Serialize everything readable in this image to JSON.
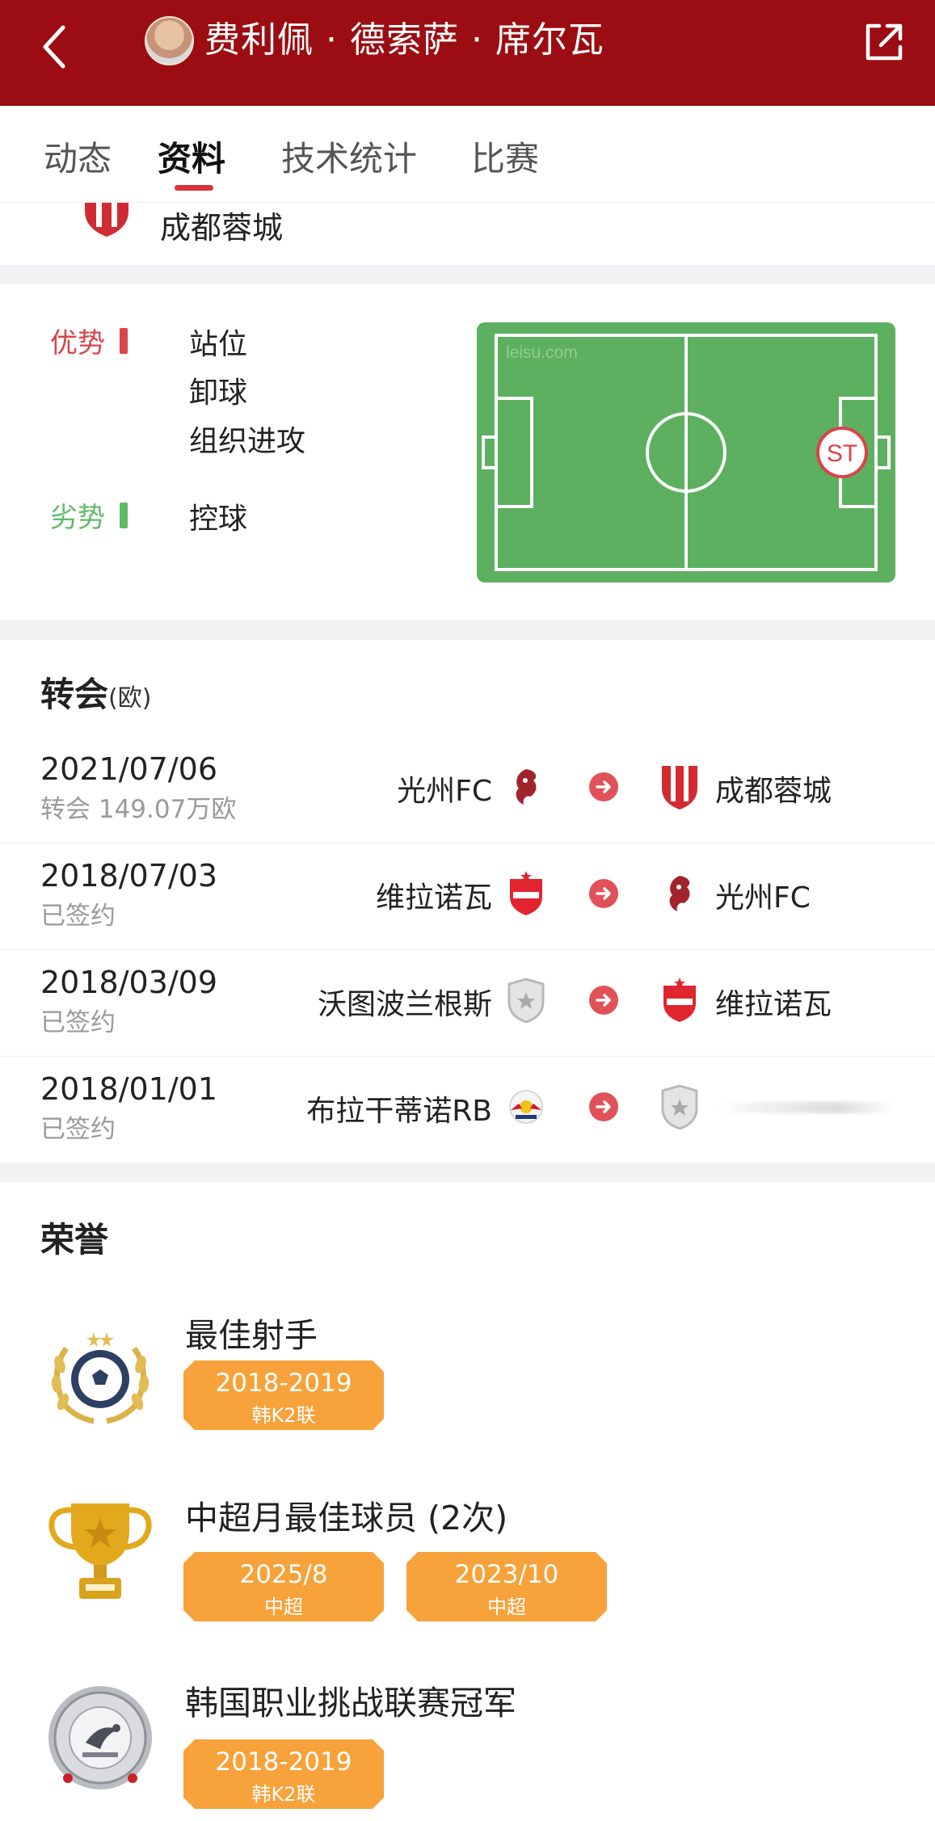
{
  "header": {
    "player_name": "费利佩 · 德索萨 · 席尔瓦",
    "back_icon": "chevron-left-icon",
    "share_icon": "share-icon"
  },
  "tabs": [
    {
      "label": "动态"
    },
    {
      "label": "资料"
    },
    {
      "label": "技术统计"
    },
    {
      "label": "比赛"
    }
  ],
  "active_tab": "资料",
  "current_club": {
    "name": "成都蓉城"
  },
  "position_card": {
    "advantage_label": "优势",
    "disadvantage_label": "劣势",
    "advantages": [
      "站位",
      "卸球",
      "组织进攻"
    ],
    "disadvantages": [
      "控球"
    ],
    "watermark": "leisu.com",
    "position_marker": "ST",
    "colors": {
      "advantage": "#d8454b",
      "disadvantage": "#5fbb68",
      "pitch": "#5cb05f"
    }
  },
  "transfers": {
    "title": "转会",
    "unit": "(欧)",
    "rows": [
      {
        "date": "2021/07/06",
        "note": "转会 149.07万欧",
        "from": "光州FC",
        "to": "成都蓉城"
      },
      {
        "date": "2018/07/03",
        "note": "已签约",
        "from": "维拉诺瓦",
        "to": "光州FC"
      },
      {
        "date": "2018/03/09",
        "note": "已签约",
        "from": "沃图波兰根斯",
        "to": "维拉诺瓦"
      },
      {
        "date": "2018/01/01",
        "note": "已签约",
        "from": "布拉干蒂诺RB",
        "to": ""
      }
    ]
  },
  "honors": {
    "title": "荣誉",
    "items": [
      {
        "title": "最佳射手",
        "icon": "golden-boot-laurel-icon",
        "badges": [
          {
            "main": "2018-2019",
            "sub": "韩K2联"
          }
        ]
      },
      {
        "title": "中超月最佳球员 (2次)",
        "icon": "trophy-cup-icon",
        "badges": [
          {
            "main": "2025/8",
            "sub": "中超"
          },
          {
            "main": "2023/10",
            "sub": "中超"
          }
        ]
      },
      {
        "title": "韩国职业挑战联赛冠军",
        "icon": "league-plate-icon",
        "badges": [
          {
            "main": "2018-2019",
            "sub": "韩K2联"
          }
        ]
      }
    ]
  },
  "accent_color": "#9b0d12",
  "badge_color": "#f7a23a"
}
